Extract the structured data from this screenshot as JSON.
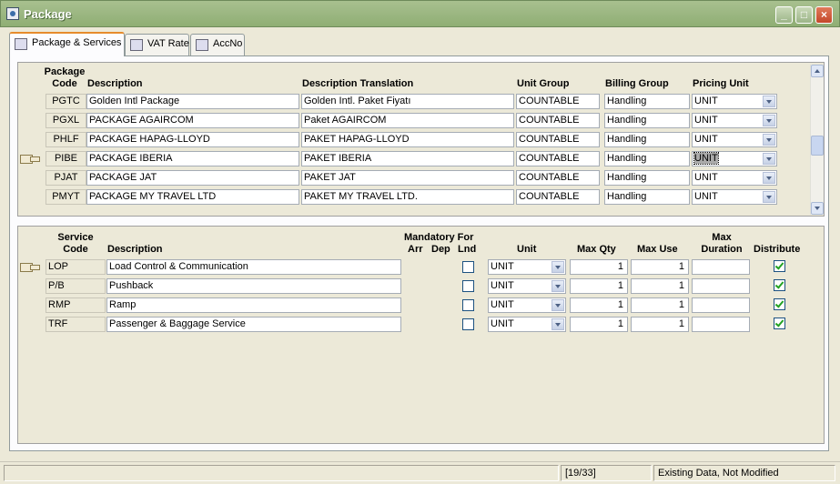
{
  "window": {
    "title": "Package"
  },
  "tabs": [
    {
      "label": "Package & Services",
      "icon": "package-icon"
    },
    {
      "label": "VAT Rate",
      "icon": "calculator-icon"
    },
    {
      "label": "AccNo",
      "icon": "account-icon"
    }
  ],
  "packages": {
    "headers": {
      "code": "Package\nCode",
      "description": "Description",
      "translation": "Description Translation",
      "unit_group": "Unit Group",
      "billing_group": "Billing Group",
      "pricing_unit": "Pricing Unit"
    },
    "rows": [
      {
        "code": "PGTC",
        "description": "Golden Intl Package",
        "translation": "Golden Intl. Paket Fiyatı",
        "unit_group": "COUNTABLE",
        "billing_group": "Handling",
        "pricing_unit": "UNIT"
      },
      {
        "code": "PGXL",
        "description": "PACKAGE AGAIRCOM",
        "translation": "Paket AGAIRCOM",
        "unit_group": "COUNTABLE",
        "billing_group": "Handling",
        "pricing_unit": "UNIT"
      },
      {
        "code": "PHLF",
        "description": "PACKAGE HAPAG-LLOYD",
        "translation": "PAKET HAPAG-LLOYD",
        "unit_group": "COUNTABLE",
        "billing_group": "Handling",
        "pricing_unit": "UNIT"
      },
      {
        "code": "PIBE",
        "description": "PACKAGE IBERIA",
        "translation": "PAKET IBERIA",
        "unit_group": "COUNTABLE",
        "billing_group": "Handling",
        "pricing_unit": "UNIT"
      },
      {
        "code": "PJAT",
        "description": "PACKAGE JAT",
        "translation": "PAKET JAT",
        "unit_group": "COUNTABLE",
        "billing_group": "Handling",
        "pricing_unit": "UNIT"
      },
      {
        "code": "PMYT",
        "description": "PACKAGE MY TRAVEL LTD",
        "translation": "PAKET MY TRAVEL LTD.",
        "unit_group": "COUNTABLE",
        "billing_group": "Handling",
        "pricing_unit": "UNIT"
      }
    ],
    "current_row": 3
  },
  "services": {
    "headers": {
      "code": "Service\nCode",
      "description": "Description",
      "mandatory_for": "Mandatory For",
      "arr": "Arr",
      "dep": "Dep",
      "lnd": "Lnd",
      "unit": "Unit",
      "max_qty": "Max Qty",
      "max_use": "Max Use",
      "max_duration": "Max\nDuration",
      "distribute": "Distribute"
    },
    "rows": [
      {
        "code": "LOP",
        "description": "Load Control & Communication",
        "lnd": false,
        "unit": "UNIT",
        "max_qty": "1",
        "max_use": "1",
        "max_duration": "",
        "distribute": true
      },
      {
        "code": "P/B",
        "description": "Pushback",
        "lnd": false,
        "unit": "UNIT",
        "max_qty": "1",
        "max_use": "1",
        "max_duration": "",
        "distribute": true
      },
      {
        "code": "RMP",
        "description": "Ramp",
        "lnd": false,
        "unit": "UNIT",
        "max_qty": "1",
        "max_use": "1",
        "max_duration": "",
        "distribute": true
      },
      {
        "code": "TRF",
        "description": "Passenger & Baggage Service",
        "lnd": false,
        "unit": "UNIT",
        "max_qty": "1",
        "max_use": "1",
        "max_duration": "",
        "distribute": true
      }
    ],
    "current_row": 0
  },
  "status": {
    "record": "[19/33]",
    "state": "Existing Data, Not Modified"
  }
}
